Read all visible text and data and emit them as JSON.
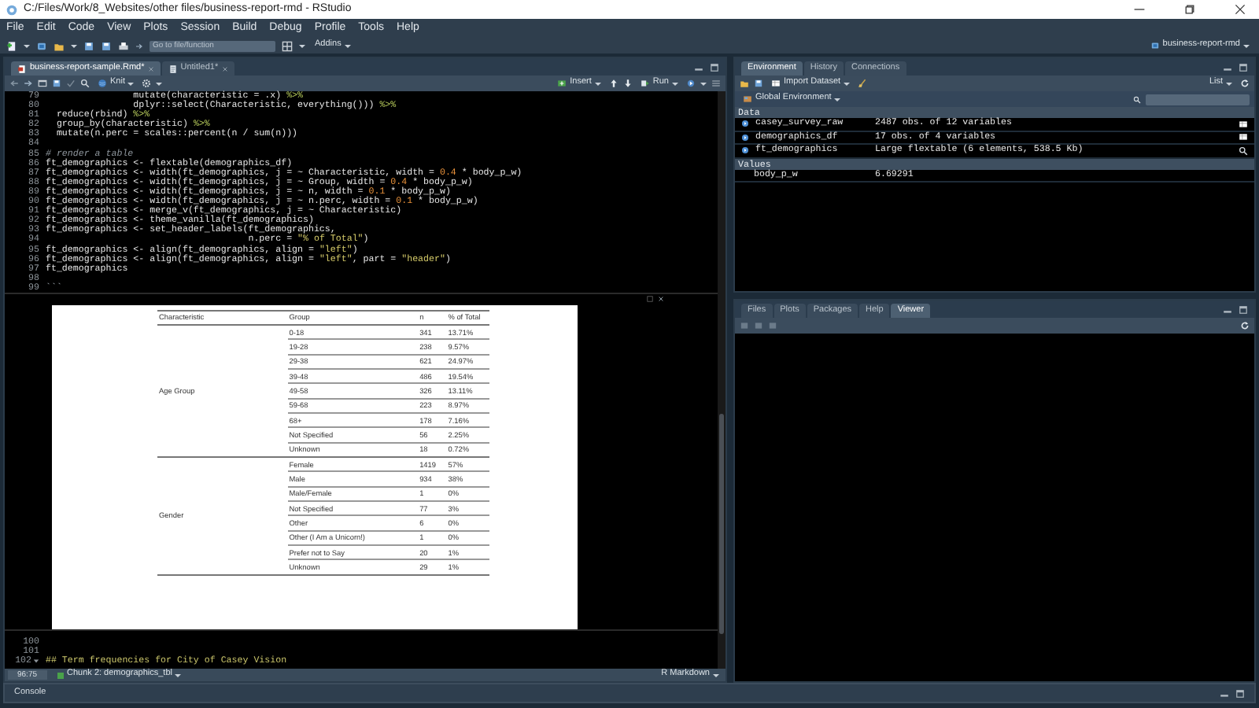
{
  "window": {
    "title": "C:/Files/Work/8_Websites/other files/business-report-rmd - RStudio"
  },
  "menu": [
    "File",
    "Edit",
    "Code",
    "View",
    "Plots",
    "Session",
    "Build",
    "Debug",
    "Profile",
    "Tools",
    "Help"
  ],
  "toolbar": {
    "goto_placeholder": "Go to file/function",
    "addins": "Addins",
    "project": "business-report-rmd"
  },
  "editor": {
    "tabs": [
      {
        "label": "business-report-sample.Rmd*",
        "selected": true
      },
      {
        "label": "Untitled1*",
        "selected": false
      }
    ],
    "toolbar": {
      "knit": "Knit",
      "insert": "Insert",
      "run": "Run"
    },
    "lines": [
      {
        "number": "79",
        "tokens": [
          {
            "kind": "plain",
            "text": "                mutate(characteristic = .x) "
          },
          {
            "kind": "op",
            "text": "%>%"
          }
        ]
      },
      {
        "number": "80",
        "tokens": [
          {
            "kind": "plain",
            "text": "                dplyr::select(Characteristic, everything())) "
          },
          {
            "kind": "op",
            "text": "%>%"
          }
        ]
      },
      {
        "number": "81",
        "tokens": [
          {
            "kind": "plain",
            "text": "  reduce(rbind) "
          },
          {
            "kind": "op",
            "text": "%>%"
          }
        ]
      },
      {
        "number": "82",
        "tokens": [
          {
            "kind": "plain",
            "text": "  group_by(characteristic) "
          },
          {
            "kind": "op",
            "text": "%>%"
          }
        ]
      },
      {
        "number": "83",
        "tokens": [
          {
            "kind": "plain",
            "text": "  mutate(n.perc = scales::percent(n / sum(n)))"
          }
        ]
      },
      {
        "number": "84"
      },
      {
        "number": "85",
        "tokens": [
          {
            "kind": "comment",
            "text": "# render a table"
          }
        ]
      },
      {
        "number": "86",
        "tokens": [
          {
            "kind": "plain",
            "text": "ft_demographics <- flextable(demographics_df)"
          }
        ]
      },
      {
        "number": "87",
        "tokens": [
          {
            "kind": "plain",
            "text": "ft_demographics <- width(ft_demographics, j = ~ Characteristic, width = "
          },
          {
            "kind": "num",
            "text": "0.4"
          },
          {
            "kind": "plain",
            "text": " * body_p_w)"
          }
        ]
      },
      {
        "number": "88",
        "tokens": [
          {
            "kind": "plain",
            "text": "ft_demographics <- width(ft_demographics, j = ~ Group, width = "
          },
          {
            "kind": "num",
            "text": "0.4"
          },
          {
            "kind": "plain",
            "text": " * body_p_w)"
          }
        ]
      },
      {
        "number": "89",
        "tokens": [
          {
            "kind": "plain",
            "text": "ft_demographics <- width(ft_demographics, j = ~ n, width = "
          },
          {
            "kind": "num",
            "text": "0.1"
          },
          {
            "kind": "plain",
            "text": " * body_p_w)"
          }
        ]
      },
      {
        "number": "90",
        "tokens": [
          {
            "kind": "plain",
            "text": "ft_demographics <- width(ft_demographics, j = ~ n.perc, width = "
          },
          {
            "kind": "num",
            "text": "0.1"
          },
          {
            "kind": "plain",
            "text": " * body_p_w)"
          }
        ]
      },
      {
        "number": "91",
        "tokens": [
          {
            "kind": "plain",
            "text": "ft_demographics <- merge_v(ft_demographics, j = ~ Characteristic)"
          }
        ]
      },
      {
        "number": "92",
        "tokens": [
          {
            "kind": "plain",
            "text": "ft_demographics <- theme_vanilla(ft_demographics)"
          }
        ]
      },
      {
        "number": "93",
        "tokens": [
          {
            "kind": "plain",
            "text": "ft_demographics <- set_header_labels(ft_demographics,"
          }
        ]
      },
      {
        "number": "94",
        "tokens": [
          {
            "kind": "plain",
            "text": "                                     n.perc = "
          },
          {
            "kind": "str",
            "text": "\"% of Total\""
          },
          {
            "kind": "plain",
            "text": ")"
          }
        ]
      },
      {
        "number": "95",
        "tokens": [
          {
            "kind": "plain",
            "text": "ft_demographics <- align(ft_demographics, align = "
          },
          {
            "kind": "str",
            "text": "\"left\""
          },
          {
            "kind": "plain",
            "text": ")"
          }
        ]
      },
      {
        "number": "96",
        "tokens": [
          {
            "kind": "plain",
            "text": "ft_demographics <- align(ft_demographics, align = "
          },
          {
            "kind": "str",
            "text": "\"left\""
          },
          {
            "kind": "plain",
            "text": ", part = "
          },
          {
            "kind": "str",
            "text": "\"header\""
          },
          {
            "kind": "plain",
            "text": ")"
          }
        ]
      },
      {
        "number": "97",
        "tokens": [
          {
            "kind": "plain",
            "text": "ft_demographics"
          }
        ]
      },
      {
        "number": "98"
      },
      {
        "number": "99",
        "tokens": [
          {
            "kind": "fence",
            "text": "```"
          }
        ]
      }
    ],
    "output_table": {
      "columns": [
        "Characteristic",
        "Group",
        "n",
        "% of Total"
      ],
      "groups": [
        {
          "characteristic": "Age Group",
          "rows": [
            {
              "group": "0-18",
              "n": "341",
              "percent": "13.71%"
            },
            {
              "group": "19-28",
              "n": "238",
              "percent": "9.57%"
            },
            {
              "group": "29-38",
              "n": "621",
              "percent": "24.97%"
            },
            {
              "group": "39-48",
              "n": "486",
              "percent": "19.54%"
            },
            {
              "group": "49-58",
              "n": "326",
              "percent": "13.11%"
            },
            {
              "group": "59-68",
              "n": "223",
              "percent": "8.97%"
            },
            {
              "group": "68+",
              "n": "178",
              "percent": "7.16%"
            },
            {
              "group": "Not Specified",
              "n": "56",
              "percent": "2.25%"
            },
            {
              "group": "Unknown",
              "n": "18",
              "percent": "0.72%"
            }
          ]
        },
        {
          "characteristic": "Gender",
          "rows": [
            {
              "group": "Female",
              "n": "1419",
              "percent": "57%"
            },
            {
              "group": "Male",
              "n": "934",
              "percent": "38%"
            },
            {
              "group": "Male/Female",
              "n": "1",
              "percent": "0%"
            },
            {
              "group": "Not Specified",
              "n": "77",
              "percent": "3%"
            },
            {
              "group": "Other",
              "n": "6",
              "percent": "0%"
            },
            {
              "group": "Other (I Am a Unicorn!)",
              "n": "1",
              "percent": "0%"
            },
            {
              "group": "Prefer not to Say",
              "n": "20",
              "percent": "1%"
            },
            {
              "group": "Unknown",
              "n": "29",
              "percent": "1%"
            }
          ]
        }
      ]
    },
    "lines_after": [
      {
        "number": "100",
        "foldable": false
      },
      {
        "number": "101",
        "foldable": false
      },
      {
        "number": "102",
        "foldable": true,
        "tokens": [
          {
            "kind": "heading",
            "text": "## Term frequencies for City of Casey Vision"
          }
        ]
      }
    ],
    "status": {
      "position": "96:75",
      "chunk": "Chunk 2: demographics_tbl",
      "mode": "R Markdown"
    }
  },
  "console": {
    "title": "Console"
  },
  "environment": {
    "tabs": [
      {
        "label": "Environment",
        "selected": true
      },
      {
        "label": "History",
        "selected": false
      },
      {
        "label": "Connections",
        "selected": false
      }
    ],
    "import": "Import Dataset",
    "view_mode": "List",
    "scope": "Global Environment",
    "data_heading": "Data",
    "data": [
      {
        "name": "casey_survey_raw",
        "value": "2487 obs. of 12 variables",
        "kind": "table"
      },
      {
        "name": "demographics_df",
        "value": "17 obs. of 4 variables",
        "kind": "table"
      },
      {
        "name": "ft_demographics",
        "value": "Large flextable (6 elements, 538.5 Kb)",
        "kind": "object"
      }
    ],
    "values_heading": "Values",
    "values": [
      {
        "name": "body_p_w",
        "value": "6.69291"
      }
    ]
  },
  "viewer": {
    "tabs": [
      {
        "label": "Files",
        "selected": false
      },
      {
        "label": "Plots",
        "selected": false
      },
      {
        "label": "Packages",
        "selected": false
      },
      {
        "label": "Help",
        "selected": false
      },
      {
        "label": "Viewer",
        "selected": true
      }
    ]
  }
}
